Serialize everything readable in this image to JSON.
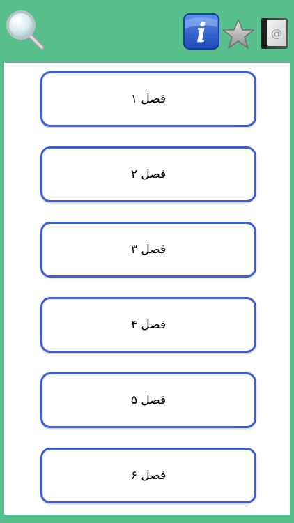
{
  "toolbar": {
    "search_icon": "magnifier-icon",
    "info_icon": "info-icon",
    "info_glyph": "i",
    "favorites_icon": "star-icon",
    "contact_icon": "address-book-icon",
    "contact_glyph": "@"
  },
  "colors": {
    "background": "#57bf8b",
    "panel": "#ffffff",
    "button_border": "#3c5fd8",
    "info_blue": "#1f55c9"
  },
  "chapters": [
    {
      "label": "فصل ۱"
    },
    {
      "label": "فصل ۲"
    },
    {
      "label": "فصل ۳"
    },
    {
      "label": "فصل ۴"
    },
    {
      "label": "فصل ۵"
    },
    {
      "label": "فصل ۶"
    }
  ]
}
